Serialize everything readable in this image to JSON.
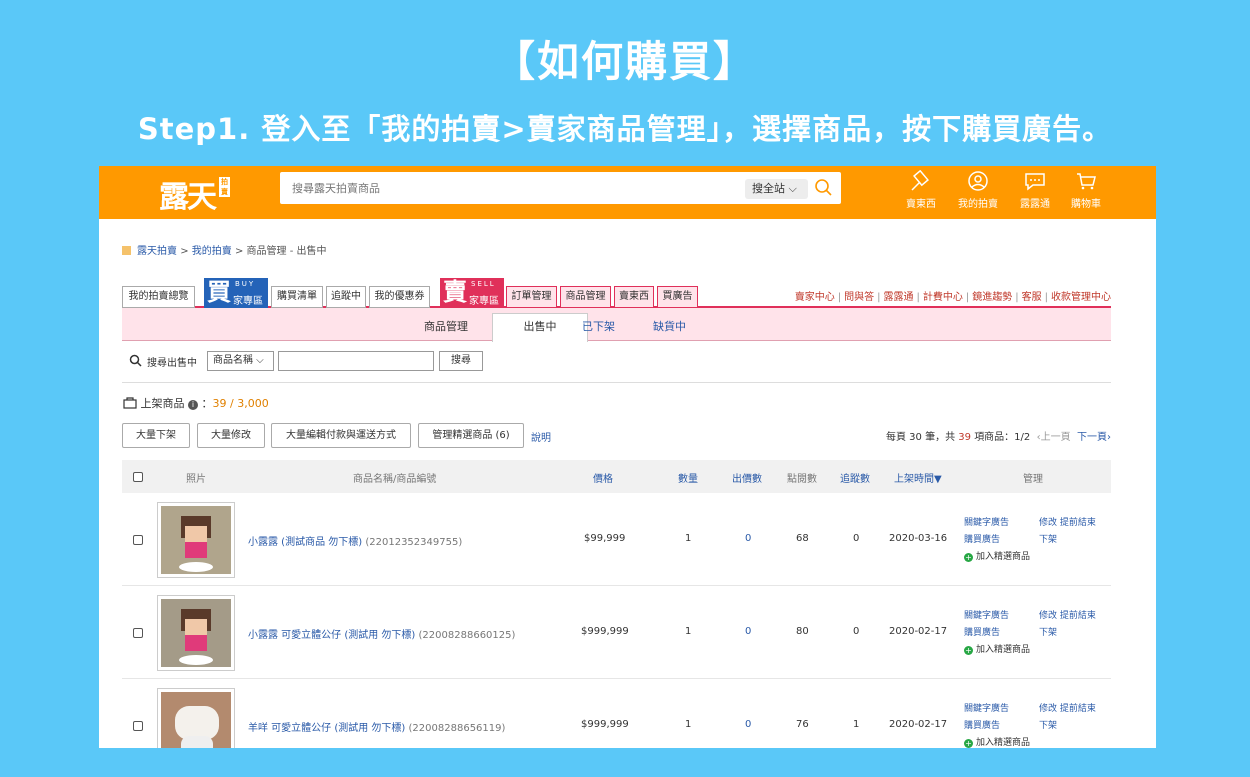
{
  "heading": {
    "title": "【如何購買】",
    "subtitle": "Step1. 登入至「我的拍賣>賣家商品管理」，選擇商品，按下購買廣告。"
  },
  "topbar": {
    "logo_text": "露天",
    "logo_badge": "拍賣",
    "search_placeholder": "搜尋露天拍賣商品",
    "search_scope": "搜全站",
    "nav": [
      {
        "label": "賣東西",
        "icon": "gavel-icon"
      },
      {
        "label": "我的拍賣",
        "icon": "user-icon"
      },
      {
        "label": "露露通",
        "icon": "chat-icon"
      },
      {
        "label": "購物車",
        "icon": "cart-icon"
      }
    ]
  },
  "breadcrumb": {
    "part1": "露天拍賣",
    "sep1": ">",
    "part2": "我的拍賣",
    "sep2": ">",
    "part3": "商品管理 - 出售中"
  },
  "tabs": {
    "overview": "我的拍賣總覽",
    "buy_big": "買",
    "buy_small": "BUY",
    "buy_zone": "家專區",
    "buy_tabs": [
      "購買清單",
      "追蹤中",
      "我的優惠券"
    ],
    "sell_big": "賣",
    "sell_small": "SELL",
    "sell_zone": "家專區",
    "sell_tabs": [
      "訂單管理",
      "商品管理",
      "賣東西",
      "買廣告"
    ],
    "right_links": [
      "賣家中心",
      "問與答",
      "露露通",
      "計費中心",
      "鏡進趨勢",
      "客服",
      "收款管理中心"
    ]
  },
  "subtabs": {
    "title": "商品管理",
    "items": [
      "出售中",
      "已下架",
      "缺貨中"
    ]
  },
  "filter": {
    "label": "搜尋出售中",
    "select": "商品名稱",
    "button": "搜尋"
  },
  "listed": {
    "label": "上架商品",
    "count": "39",
    "limit": "3,000"
  },
  "actions": {
    "buttons": [
      "大量下架",
      "大量修改",
      "大量編輯付款與運送方式",
      "管理精選商品 (6)"
    ],
    "help": "說明"
  },
  "pager": {
    "per_page_prefix": "每頁 30 筆，共",
    "total": "39",
    "per_page_suffix": "項商品：1/2",
    "prev": "‹上一頁",
    "next": "下一頁›"
  },
  "table": {
    "headers": [
      "照片",
      "商品名稱/商品編號",
      "價格",
      "數量",
      "出價數",
      "點閱數",
      "追蹤數",
      "上架時間▼",
      "管理"
    ],
    "rows": [
      {
        "name": "小露露 (測試商品 勿下標)",
        "id": "(22012352349755)",
        "price": "$99,999",
        "qty": "1",
        "bids": "0",
        "views": "68",
        "watch": "0",
        "date": "2020-03-16",
        "thumb_color": "#b0a58c"
      },
      {
        "name": "小露露 可愛立體公仔 (測試用 勿下標)",
        "id": "(22008288660125)",
        "price": "$999,999",
        "qty": "1",
        "bids": "0",
        "views": "80",
        "watch": "0",
        "date": "2020-02-17",
        "thumb_color": "#a49b88"
      },
      {
        "name": "羊咩 可愛立體公仔 (測試用 勿下標)",
        "id": "(22008288656119)",
        "price": "$999,999",
        "qty": "1",
        "bids": "0",
        "views": "76",
        "watch": "1",
        "date": "2020-02-17",
        "thumb_color": "#b38a6e"
      }
    ],
    "ops": {
      "keyword_ad": "關鍵字廣告",
      "buy_ad": "購買廣告",
      "add_featured": "加入精選商品",
      "edit": "修改",
      "end_early": "提前結束",
      "delist": "下架"
    }
  }
}
